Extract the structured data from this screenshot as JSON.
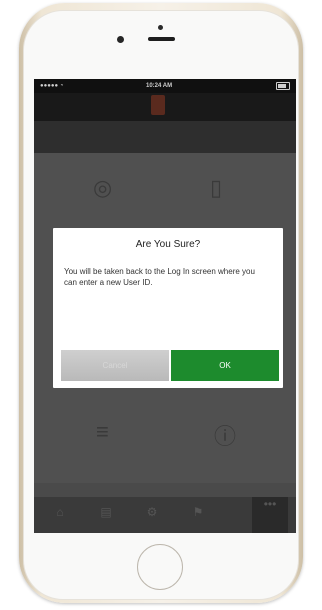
{
  "status_bar": {
    "time": "10:24 AM"
  },
  "dialog": {
    "title": "Are You Sure?",
    "message": "You will be taken back to the Log In screen where you can enter a new User ID.",
    "cancel_label": "Cancel",
    "ok_label": "OK"
  },
  "colors": {
    "ok_button": "#1d8b2d",
    "overlay": "#4a4a4a",
    "header": "#191919"
  },
  "icons": [
    "signal-icon",
    "battery-icon",
    "home-icon",
    "tab-icon"
  ]
}
